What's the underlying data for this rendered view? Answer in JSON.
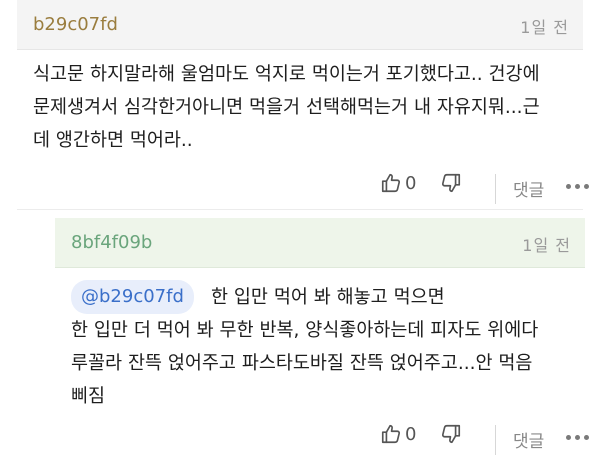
{
  "comments": [
    {
      "author": "b29c07fd",
      "time": "1일 전",
      "text": "식고문 하지말라해 울엄마도 억지로 먹이는거 포기했다고.. 건강에\n문제생겨서 심각한거아니면 먹을거 선택해먹는거 내 자유지뭐...근\n데 앵간하면 먹어라..",
      "dislike_count": "0",
      "reply_label": "댓글"
    }
  ],
  "reply": {
    "author": "8bf4f09b",
    "time": "1일 전",
    "mention": "@b29c07fd",
    "text_first": "한 입만 먹어 봐 해놓고 먹으면",
    "text_rest": "한 입만 더 먹어 봐 무한 반복, 양식좋아하는데 피자도 위에다\n루꼴라 잔뜩 얹어주고 파스타도바질 잔뜩 얹어주고...안 먹음\n삐짐",
    "dislike_count": "0",
    "reply_label": "댓글"
  },
  "icons": {
    "like": "thumbs-up-icon",
    "dislike": "thumbs-down-icon",
    "more": "more-dots-icon"
  }
}
